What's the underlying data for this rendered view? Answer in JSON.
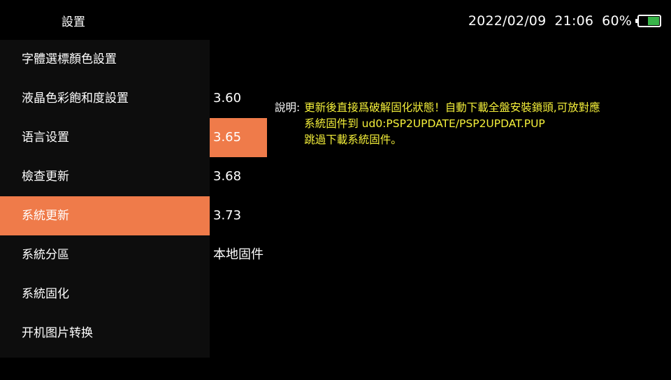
{
  "header": {
    "title": "設置",
    "date": "2022/02/09",
    "time": "21:06",
    "battery_percent": "60%",
    "battery_level": 0.6,
    "battery_color": "#39b54a"
  },
  "menu": {
    "items": [
      {
        "label": "字體選標顏色設置"
      },
      {
        "label": "液晶色彩飽和度設置"
      },
      {
        "label": "语言设置"
      },
      {
        "label": "檢查更新"
      },
      {
        "label": "系統更新"
      },
      {
        "label": "系統分區"
      },
      {
        "label": "系統固化"
      },
      {
        "label": "开机图片转换"
      }
    ],
    "selected_index": 4
  },
  "submenu": {
    "items": [
      {
        "label": "3.60"
      },
      {
        "label": "3.65"
      },
      {
        "label": "3.68"
      },
      {
        "label": "3.73"
      },
      {
        "label": "本地固件"
      }
    ],
    "selected_index": 1
  },
  "description": {
    "label": "說明:",
    "lines": [
      "更新後直接爲破解固化狀態！自動下載全盤安裝鎖頭,可放對應",
      "系統固件到 ud0:PSP2UPDATE/PSP2UPDAT.PUP",
      "跳過下載系統固件。"
    ]
  },
  "colors": {
    "accent": "#ef7b4a",
    "description_text": "#f5f03a",
    "menu_background": "#0d0d0d",
    "background": "#000000"
  }
}
